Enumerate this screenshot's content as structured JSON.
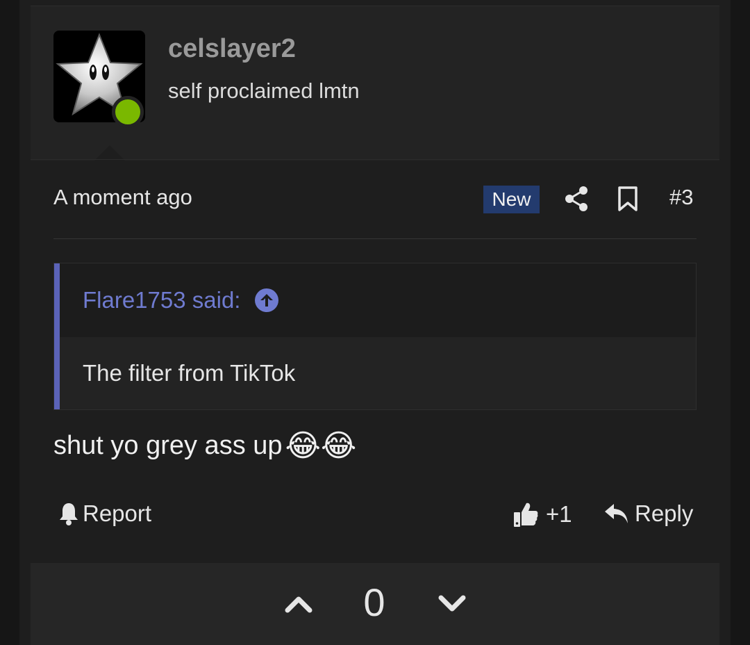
{
  "post": {
    "username": "celslayer2",
    "user_title": "self proclaimed lmtn",
    "avatar_icon": "star-face-icon",
    "online_color": "#7ab800",
    "timestamp": "A moment ago",
    "badge": "New",
    "post_number": "#3",
    "quote": {
      "author": "Flare1753 said:",
      "text": "The filter from TikTok"
    },
    "message": "shut yo grey ass up",
    "emoji": "😂😂",
    "actions": {
      "report": "Report",
      "like_count": "+1",
      "reply": "Reply"
    },
    "vote_count": "0"
  },
  "colors": {
    "accent_quote": "#5b63b8",
    "badge_bg": "#233b6e"
  }
}
